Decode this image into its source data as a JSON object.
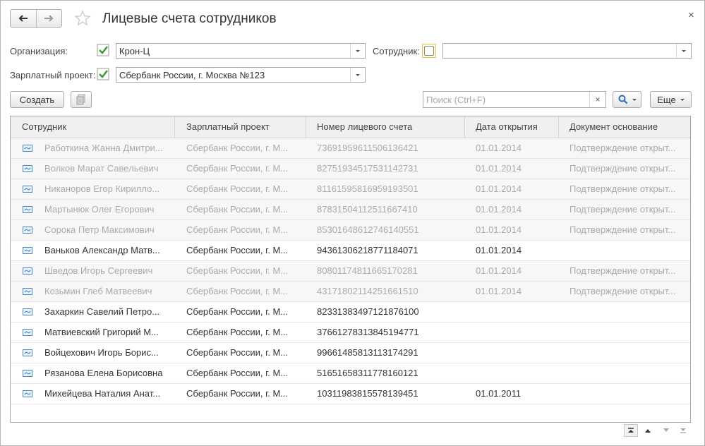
{
  "window": {
    "title": "Лицевые счета сотрудников",
    "close_label": "×"
  },
  "filters": {
    "organization_label": "Организация:",
    "organization_value": "Крон-Ц",
    "salary_project_label": "Зарплатный проект:",
    "salary_project_value": "Сбербанк России, г. Москва №123",
    "employee_label": "Сотрудник:",
    "employee_value": ""
  },
  "toolbar": {
    "create_label": "Создать",
    "search_placeholder": "Поиск (Ctrl+F)",
    "search_clear": "×",
    "more_label": "Еще"
  },
  "table": {
    "columns": [
      "Сотрудник",
      "Зарплатный проект",
      "Номер лицевого счета",
      "Дата открытия",
      "Документ основание"
    ],
    "rows": [
      {
        "employee": "Работкина Жанна Дмитри...",
        "project": "Сбербанк России, г. М...",
        "account": "73691959611506136421",
        "date": "01.01.2014",
        "document": "Подтверждение открыт...",
        "marked": true
      },
      {
        "employee": "Волков Марат Савельевич",
        "project": "Сбербанк России, г. М...",
        "account": "82751934517531142731",
        "date": "01.01.2014",
        "document": "Подтверждение открыт...",
        "marked": true
      },
      {
        "employee": "Никаноров Егор Кирилло...",
        "project": "Сбербанк России, г. М...",
        "account": "81161595816959193501",
        "date": "01.01.2014",
        "document": "Подтверждение открыт...",
        "marked": true
      },
      {
        "employee": "Мартынюк Олег Егорович",
        "project": "Сбербанк России, г. М...",
        "account": "87831504112511667410",
        "date": "01.01.2014",
        "document": "Подтверждение открыт...",
        "marked": true
      },
      {
        "employee": "Сорока Петр Максимович",
        "project": "Сбербанк России, г. М...",
        "account": "85301648612746140551",
        "date": "01.01.2014",
        "document": "Подтверждение открыт...",
        "marked": true
      },
      {
        "employee": "Ваньков Александр Матв...",
        "project": "Сбербанк России, г. М...",
        "account": "94361306218771184071",
        "date": "01.01.2014",
        "document": "",
        "marked": false
      },
      {
        "employee": "Шведов Игорь Сергеевич",
        "project": "Сбербанк России, г. М...",
        "account": "80801174811665170281",
        "date": "01.01.2014",
        "document": "Подтверждение открыт...",
        "marked": true
      },
      {
        "employee": "Козьмин Глеб Матвеевич",
        "project": "Сбербанк России, г. М...",
        "account": "43171802114251661510",
        "date": "01.01.2014",
        "document": "Подтверждение открыт...",
        "marked": true
      },
      {
        "employee": "Захаркин Савелий Петро...",
        "project": "Сбербанк России, г. М...",
        "account": "82331383497121876100",
        "date": "",
        "document": "",
        "marked": false
      },
      {
        "employee": "Матвиевский Григорий М...",
        "project": "Сбербанк России, г. М...",
        "account": "37661278313845194771",
        "date": "",
        "document": "",
        "marked": false
      },
      {
        "employee": "Войцехович Игорь Борис...",
        "project": "Сбербанк России, г. М...",
        "account": "99661485813113174291",
        "date": "",
        "document": "",
        "marked": false
      },
      {
        "employee": "Рязанова Елена Борисовна",
        "project": "Сбербанк России, г. М...",
        "account": "51651658311778160121",
        "date": "",
        "document": "",
        "marked": false
      },
      {
        "employee": "Михейцева Наталия Анат...",
        "project": "Сбербанк России, г. М...",
        "account": "10311983815578139451",
        "date": "01.01.2011",
        "document": "",
        "marked": false
      }
    ]
  },
  "colors": {
    "check_green": "#3a9a3a",
    "record_icon_blue": "#4a86c5",
    "marked_text": "#aaaaaa",
    "search_icon": "#2a6db5"
  },
  "icons": {
    "back": "arrow-left-icon",
    "forward": "arrow-right-icon",
    "favorite": "star-icon",
    "close": "close-icon",
    "record": "record-icon",
    "search": "search-icon",
    "copy": "document-copy-icon"
  }
}
